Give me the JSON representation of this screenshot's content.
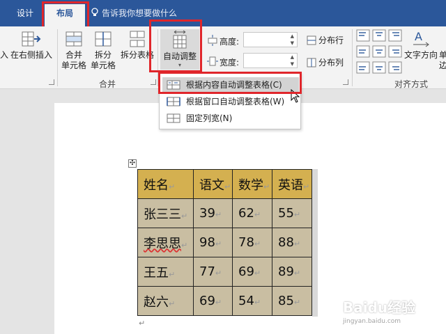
{
  "tabs": {
    "design": "设计",
    "layout": "布局"
  },
  "tell_me": "告诉我你想要做什么",
  "ribbon": {
    "insert_right_prefix": "入",
    "insert_right": "在右侧插入",
    "merge_cells": [
      "合并",
      "单元格"
    ],
    "split_cells": [
      "拆分",
      "单元格"
    ],
    "split_table": "拆分表格",
    "merge_group": "合并",
    "autofit": "自动调整",
    "height_label": "高度:",
    "width_label": "宽度:",
    "distribute_rows": "分布行",
    "distribute_cols": "分布列",
    "text_direction": "文字方向",
    "cell_margin_partial": [
      "单",
      "边"
    ],
    "alignment_group": "对齐方式"
  },
  "dropdown": {
    "items": [
      {
        "label": "根据内容自动调整表格(C)",
        "highlighted": true
      },
      {
        "label": "根据窗口自动调整表格(W)",
        "highlighted": false
      },
      {
        "label": "固定列宽(N)",
        "highlighted": false
      }
    ]
  },
  "table": {
    "header": [
      "姓名",
      "语文",
      "数学",
      "英语"
    ],
    "rows": [
      [
        "张三三",
        "39",
        "62",
        "55"
      ],
      [
        "李思思",
        "98",
        "78",
        "88"
      ],
      [
        "王五",
        "77",
        "69",
        "89"
      ],
      [
        "赵六",
        "69",
        "54",
        "85"
      ]
    ]
  },
  "colors": {
    "tabbar": "#2b579a",
    "highlight_box": "#e0262b",
    "header_fill": "#d4b050",
    "cell_fill": "#c9bea2"
  },
  "watermark": {
    "brand": "Baidu经验",
    "url": "jingyan.baidu.com"
  }
}
